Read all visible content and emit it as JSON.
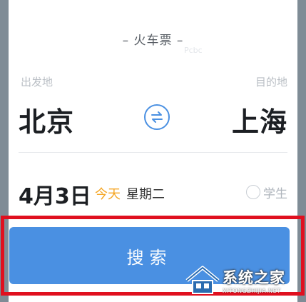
{
  "ticket_type": "– 火车票 –",
  "watermark_top": "Pcbc",
  "route": {
    "from_label": "出发地",
    "to_label": "目的地",
    "from_city": "北京",
    "to_city": "上海"
  },
  "swap_icon": "swap-arrows-icon",
  "date": {
    "value": "4月3日",
    "today": "今天",
    "weekday": "星期二"
  },
  "student": {
    "label": "学生",
    "checked": false
  },
  "search_button": "搜索",
  "watermark": {
    "name": "系统之家",
    "url": "XITONGZHIJIA.NET"
  },
  "colors": {
    "accent": "#4a90e2",
    "today": "#f5a623",
    "highlight": "#e0101f"
  }
}
